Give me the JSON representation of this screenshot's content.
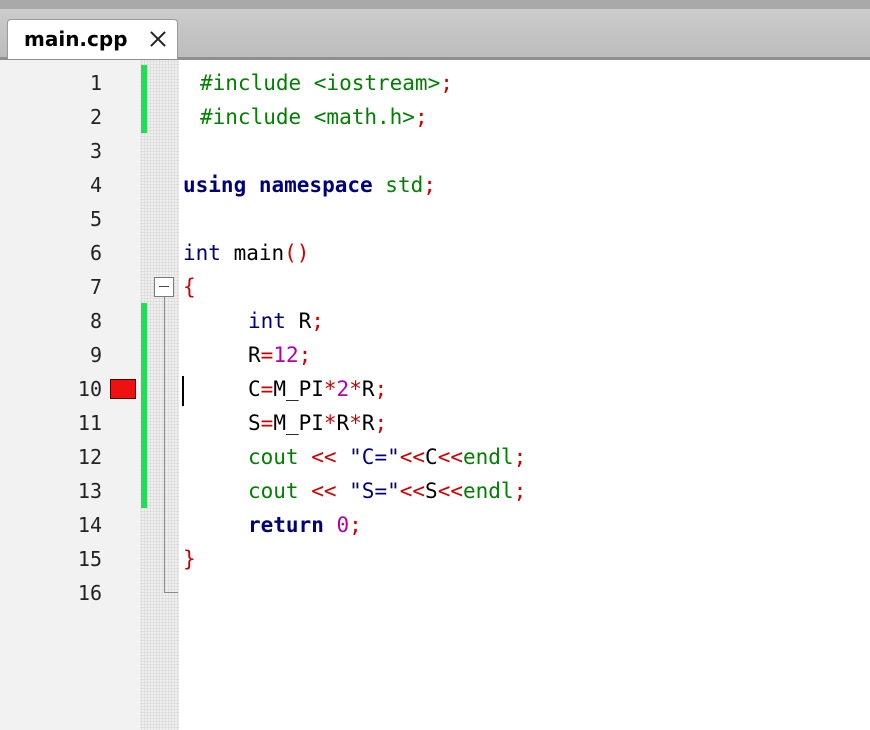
{
  "tab": {
    "title": "main.cpp",
    "close_glyph": "close-icon"
  },
  "line_numbers": [
    "1",
    "2",
    "3",
    "4",
    "5",
    "6",
    "7",
    "8",
    "9",
    "10",
    "11",
    "12",
    "13",
    "14",
    "15",
    "16"
  ],
  "bookmark_line": "10",
  "code": {
    "l1": {
      "a": "#include <iostream>",
      "b": ";"
    },
    "l2": {
      "a": "#include <math.h>",
      "b": ";"
    },
    "l4": {
      "a": "using namespace",
      "b": " std",
      "c": ";"
    },
    "l6": {
      "a": "int",
      "b": " main",
      "c": "()"
    },
    "l7": {
      "a": "{"
    },
    "l8": {
      "a": "int",
      "b": " R",
      "c": ";"
    },
    "l9": {
      "a": "R",
      "b": "=",
      "c": "12",
      "d": ";"
    },
    "l10": {
      "a": "C",
      "b": "=",
      "c": "M_PI",
      "d": "*",
      "e": "2",
      "f": "*",
      "g": "R",
      "h": ";"
    },
    "l11": {
      "a": "S",
      "b": "=",
      "c": "M_PI",
      "d": "*",
      "e": "R",
      "f": "*",
      "g": "R",
      "h": ";"
    },
    "l12": {
      "a": "cout ",
      "b": "<<",
      "c": " \"C=\"",
      "d": "<<",
      "e": "C",
      "f": "<<",
      "g": "endl",
      "h": ";"
    },
    "l13": {
      "a": "cout ",
      "b": "<<",
      "c": " \"S=\"",
      "d": "<<",
      "e": "S",
      "f": "<<",
      "g": "endl",
      "h": ";"
    },
    "l14": {
      "a": "return",
      "b": " 0",
      "c": ";"
    },
    "l15": {
      "a": "}"
    }
  },
  "colors": {
    "keyword": "#00007f",
    "preprocessor": "#007f00",
    "operator": "#cc0000",
    "number": "#b000b0",
    "change_marker": "#22dd55",
    "bookmark": "#ee1111"
  }
}
